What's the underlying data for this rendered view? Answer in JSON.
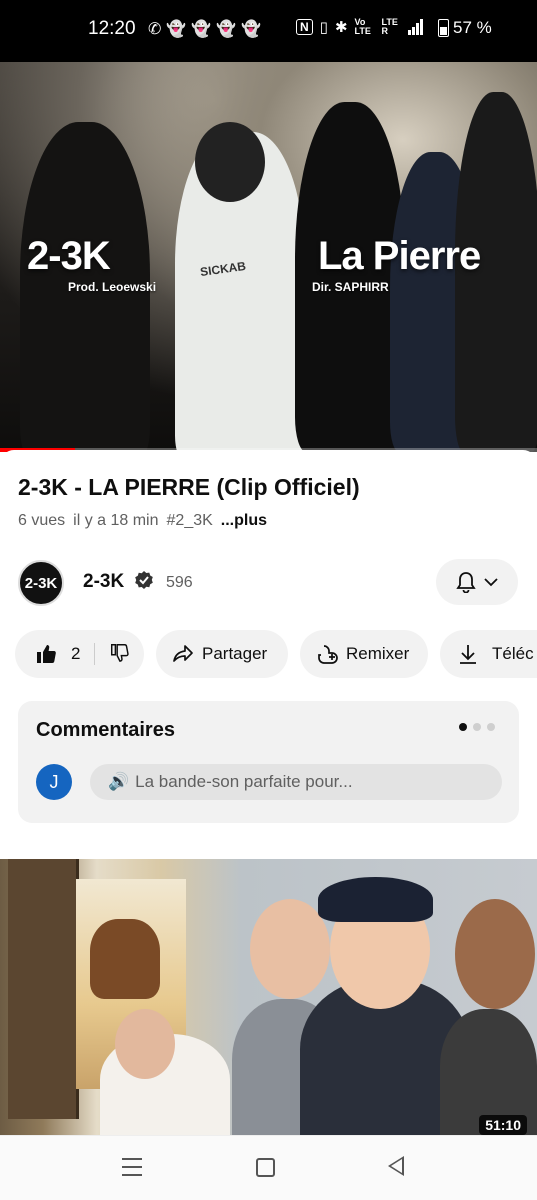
{
  "status_bar": {
    "time": "12:20",
    "battery": "57 %",
    "left_icons": [
      "whatsapp-icon",
      "snapchat-icon",
      "snapchat-icon",
      "snapchat-icon",
      "snapchat-icon"
    ],
    "right_icons": [
      "nfc-icon",
      "vibrate-icon",
      "bluetooth-icon",
      "volte-icon",
      "signal-icon"
    ],
    "volte_label": "Vo LTE",
    "lte_label": "LTE R"
  },
  "video": {
    "overlay_artist": "2-3K",
    "overlay_producer": "Prod. Leoewski",
    "overlay_song": "La Pierre",
    "overlay_director": "Dir. SAPHIRR",
    "shirt_text": "SICKAB",
    "progress": 0.14
  },
  "details": {
    "title": "2-3K - LA PIERRE (Clip Officiel)",
    "views": "6 vues",
    "age": "il y a 18 min",
    "hashtag": "#2_3K",
    "more": "...plus"
  },
  "channel": {
    "avatar_text": "2-3K",
    "name": "2-3K",
    "subscribers": "596"
  },
  "actions": {
    "likes": "2",
    "share": "Partager",
    "remix": "Remixer",
    "download": "Téléc"
  },
  "comments": {
    "header": "Commentaires",
    "user_initial": "J",
    "preview": "La bande-son parfaite pour..."
  },
  "next_video": {
    "duration": "51:10"
  },
  "colors": {
    "accent": "#ff0000",
    "comment_avatar": "#1565c0",
    "pill_bg": "#f2f2f2"
  }
}
